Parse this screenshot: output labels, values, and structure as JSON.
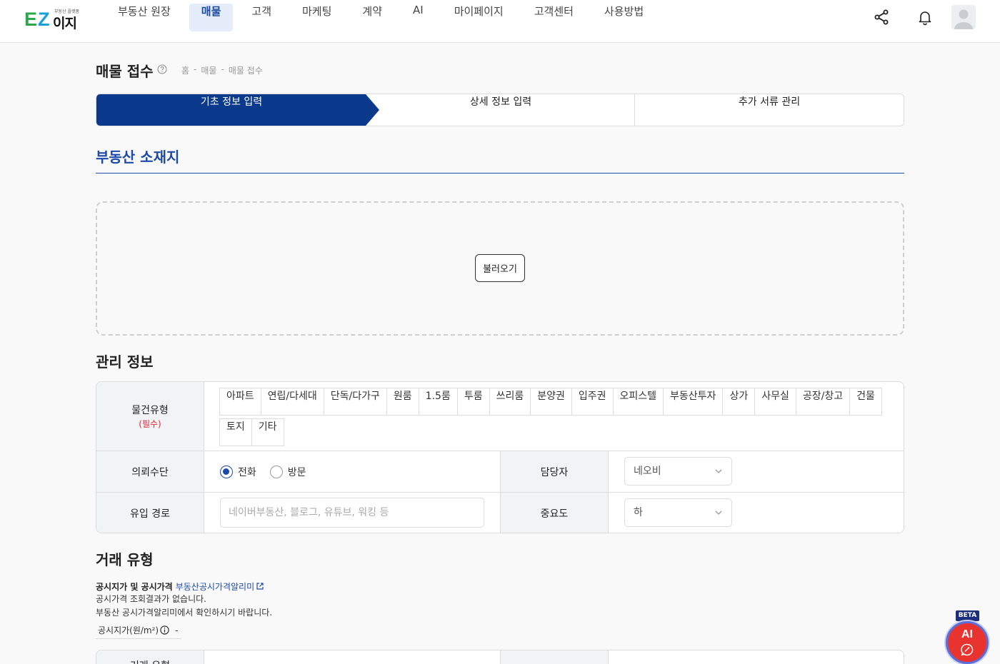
{
  "brand": {
    "logo_e": "E",
    "logo_z": "Z",
    "logo_word": "이지",
    "logo_tagline": "부동산 플랫폼"
  },
  "nav": {
    "items": [
      {
        "label": "부동산 원장"
      },
      {
        "label": "매물"
      },
      {
        "label": "고객"
      },
      {
        "label": "마케팅"
      },
      {
        "label": "계약"
      },
      {
        "label": "AI"
      },
      {
        "label": "마이페이지"
      },
      {
        "label": "고객센터"
      },
      {
        "label": "사용방법"
      }
    ],
    "active_index": 1
  },
  "page": {
    "title": "매물 접수",
    "breadcrumb": [
      "홈",
      "매물",
      "매물 접수"
    ],
    "breadcrumb_sep": "-"
  },
  "steps": [
    {
      "label": "기초 정보 입력",
      "active": true
    },
    {
      "label": "상세 정보 입력",
      "active": false
    },
    {
      "label": "추가 서류 관리",
      "active": false
    }
  ],
  "location": {
    "title": "부동산 소재지",
    "load_button": "불러오기"
  },
  "management": {
    "title": "관리 정보",
    "property_type": {
      "label": "물건유형",
      "required": "(필수)",
      "options": [
        "아파트",
        "연립/다세대",
        "단독/다가구",
        "원룸",
        "1.5룸",
        "투룸",
        "쓰리룸",
        "분양권",
        "입주권",
        "오피스텔",
        "부동산투자",
        "상가",
        "사무실",
        "공장/창고",
        "건물",
        "토지",
        "기타"
      ]
    },
    "request_method": {
      "label": "의뢰수단",
      "options": [
        "전화",
        "방문"
      ],
      "selected": "전화"
    },
    "manager": {
      "label": "담당자",
      "value": "네오비"
    },
    "source": {
      "label": "유입 경로",
      "placeholder": "네이버부동산, 블로그, 유튜브, 워킹 등"
    },
    "importance": {
      "label": "중요도",
      "value": "하"
    }
  },
  "deal": {
    "title": "거래 유형",
    "price_heading": "공시지가 및 공시가격",
    "price_link": "부동산공시가격알리미",
    "price_msg1": "공시가격 조회결과가 없습니다.",
    "price_msg2": "부동산 공시가격알리미에서 확인하시기 바랍니다.",
    "land_price_label": "공시지가(원/m²)",
    "land_price_value": "-",
    "next_row_label": "거래 유형"
  },
  "fab": {
    "beta": "BETA",
    "label": "AI"
  },
  "colors": {
    "primary": "#1d4aa8",
    "step_active": "#0b3a8c",
    "required": "#e5253a",
    "fab": "#e8332f"
  }
}
